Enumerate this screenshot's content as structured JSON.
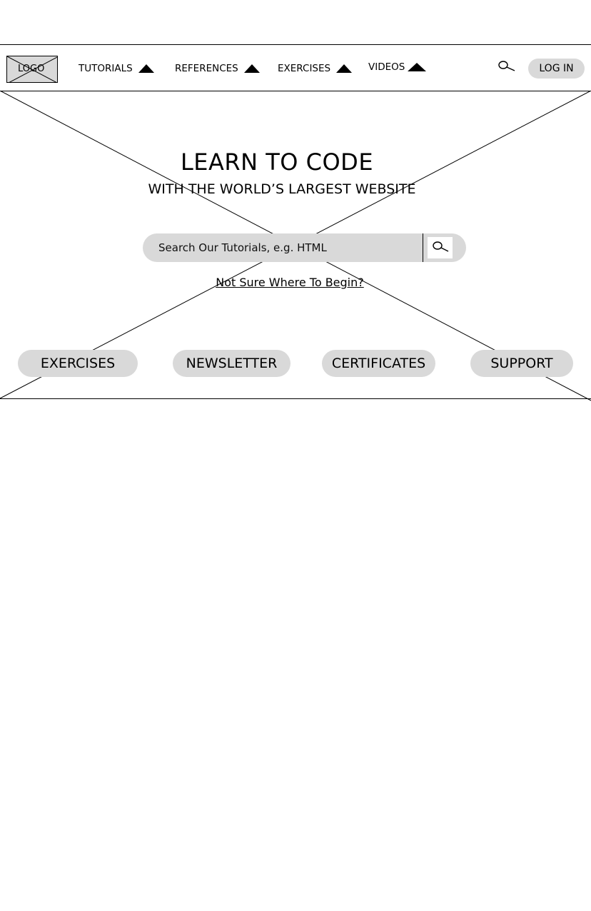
{
  "header": {
    "logo_label": "LOGO",
    "nav_items": [
      {
        "label": "TUTORIALS"
      },
      {
        "label": "REFERENCES"
      },
      {
        "label": "EXERCISES"
      },
      {
        "label": "VIDEOS"
      }
    ],
    "login_label": "LOG IN"
  },
  "hero": {
    "title": "LEARN TO CODE",
    "subtitle": "WITH THE WORLD’S LARGEST WEBSITE",
    "search": {
      "placeholder": "Search Our Tutorials, e.g. HTML",
      "value": ""
    },
    "help_link": "Not Sure Where To Begin?",
    "buttons": [
      {
        "label": "EXERCISES"
      },
      {
        "label": "NEWSLETTER"
      },
      {
        "label": "CERTIFICATES"
      },
      {
        "label": "SUPPORT"
      }
    ]
  },
  "colors": {
    "placeholder_fill": "#d9d9d9",
    "line": "#000000",
    "background": "#ffffff"
  },
  "icons": {
    "nav_search": "search-icon",
    "hero_search": "search-icon",
    "dropdown": "triangle-up-icon",
    "placeholder": "image-placeholder-x"
  }
}
